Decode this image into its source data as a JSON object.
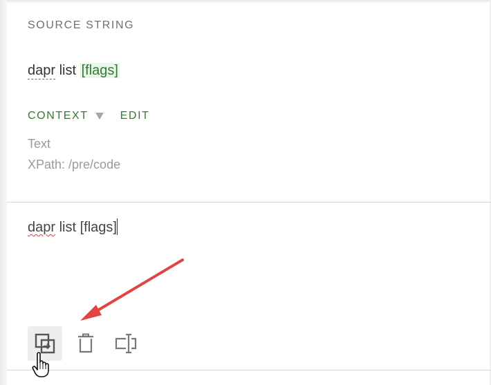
{
  "source_section": {
    "label": "SOURCE STRING",
    "text_term": "dapr",
    "text_middle": " list ",
    "text_placeholder": "[flags]"
  },
  "context": {
    "label": "CONTEXT",
    "edit_label": "EDIT",
    "type_line": "Text",
    "xpath_line": "XPath: /pre/code"
  },
  "translation": {
    "misspelled_word": "dapr",
    "rest": " list [flags]"
  },
  "toolbar": {
    "copy_source_icon": "copy-source-icon",
    "delete_icon": "trash-icon",
    "placeholder_icon": "text-cursor-box-icon"
  },
  "colors": {
    "accent_green": "#2e7d32",
    "annotation_red": "#e04545",
    "spellcheck_red": "#e53935"
  }
}
